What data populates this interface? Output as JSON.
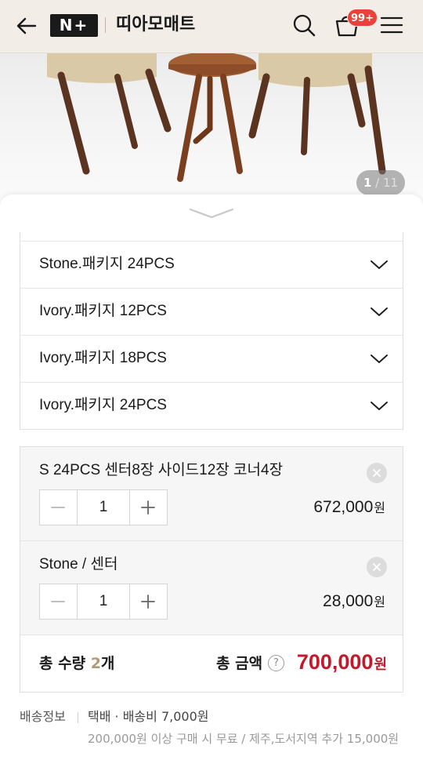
{
  "header": {
    "store_name": "띠아모매트",
    "logo_text": "N+",
    "cart_badge": "99+",
    "icons": [
      "back-arrow-icon",
      "search-icon",
      "cart-icon",
      "menu-icon"
    ]
  },
  "gallery": {
    "current": "1",
    "separator": " / ",
    "total": "11"
  },
  "options": [
    {
      "label": "Stone.패키지 24PCS"
    },
    {
      "label": "Ivory.패키지 12PCS"
    },
    {
      "label": "Ivory.패키지 18PCS"
    },
    {
      "label": "Ivory.패키지 24PCS"
    }
  ],
  "selected_items": [
    {
      "name": "S 24PCS 센터8장 사이드12장 코너4장",
      "quantity": "1",
      "price": "672,000",
      "currency": "원"
    },
    {
      "name": "Stone / 센터",
      "quantity": "1",
      "price": "28,000",
      "currency": "원"
    }
  ],
  "summary": {
    "qty_label": "총 수량",
    "qty_value": "2",
    "qty_unit": "개",
    "amount_label": "총 금액",
    "help_symbol": "?",
    "amount_value": "700,000",
    "currency": "원"
  },
  "shipping": {
    "label": "배송정보",
    "type": "택배 · 배송비 7,000원",
    "note": "200,000원 이상 구매 시 무료 / 제주,도서지역 추가 15,000원"
  },
  "colors": {
    "header_bg": "#f2ede6",
    "badge": "#e8423a",
    "total_amount": "#c4182b",
    "qty_accent": "#b29a73"
  }
}
